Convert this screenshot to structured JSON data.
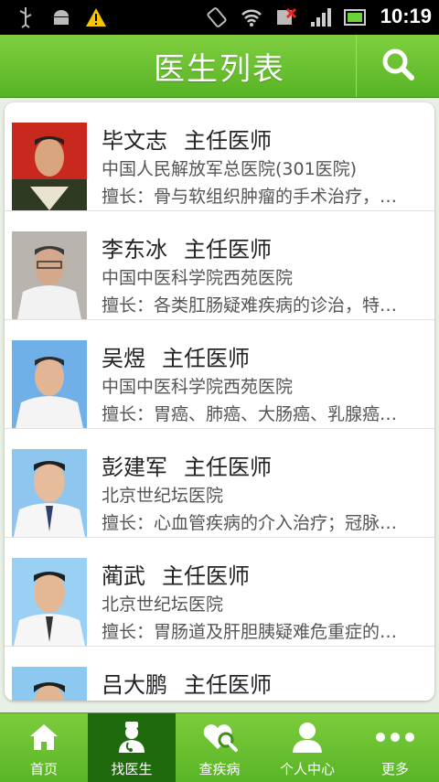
{
  "status_bar": {
    "time": "10:19"
  },
  "header": {
    "title": "医生列表"
  },
  "doctors": [
    {
      "name": "毕文志",
      "title": "主任医师",
      "hospital": "中国人民解放军总医院(301医院)",
      "specialty": "擅长：骨与软组织肿瘤的手术治疗，…"
    },
    {
      "name": "李东冰",
      "title": "主任医师",
      "hospital": "中国中医科学院西苑医院",
      "specialty": "擅长：各类肛肠疑难疾病的诊治，特…"
    },
    {
      "name": "吴煜",
      "title": "主任医师",
      "hospital": "中国中医科学院西苑医院",
      "specialty": "擅长：胃癌、肺癌、大肠癌、乳腺癌…"
    },
    {
      "name": "彭建军",
      "title": "主任医师",
      "hospital": "北京世纪坛医院",
      "specialty": "擅长：心血管疾病的介入治疗；冠脉…"
    },
    {
      "name": "蔺武",
      "title": "主任医师",
      "hospital": "北京世纪坛医院",
      "specialty": "擅长：胃肠道及肝胆胰疑难危重症的…"
    },
    {
      "name": "吕大鹏",
      "title": "主任医师"
    }
  ],
  "bottom_nav": [
    {
      "label": "首页",
      "icon": "home-icon"
    },
    {
      "label": "找医生",
      "icon": "doctor-icon",
      "active": true
    },
    {
      "label": "查疾病",
      "icon": "disease-search-icon"
    },
    {
      "label": "个人中心",
      "icon": "person-icon"
    },
    {
      "label": "更多",
      "icon": "more-dots-icon"
    }
  ],
  "colors": {
    "brand_green": "#5ab526",
    "active_tab": "#1f6a0d",
    "status_bar": "#000000"
  }
}
